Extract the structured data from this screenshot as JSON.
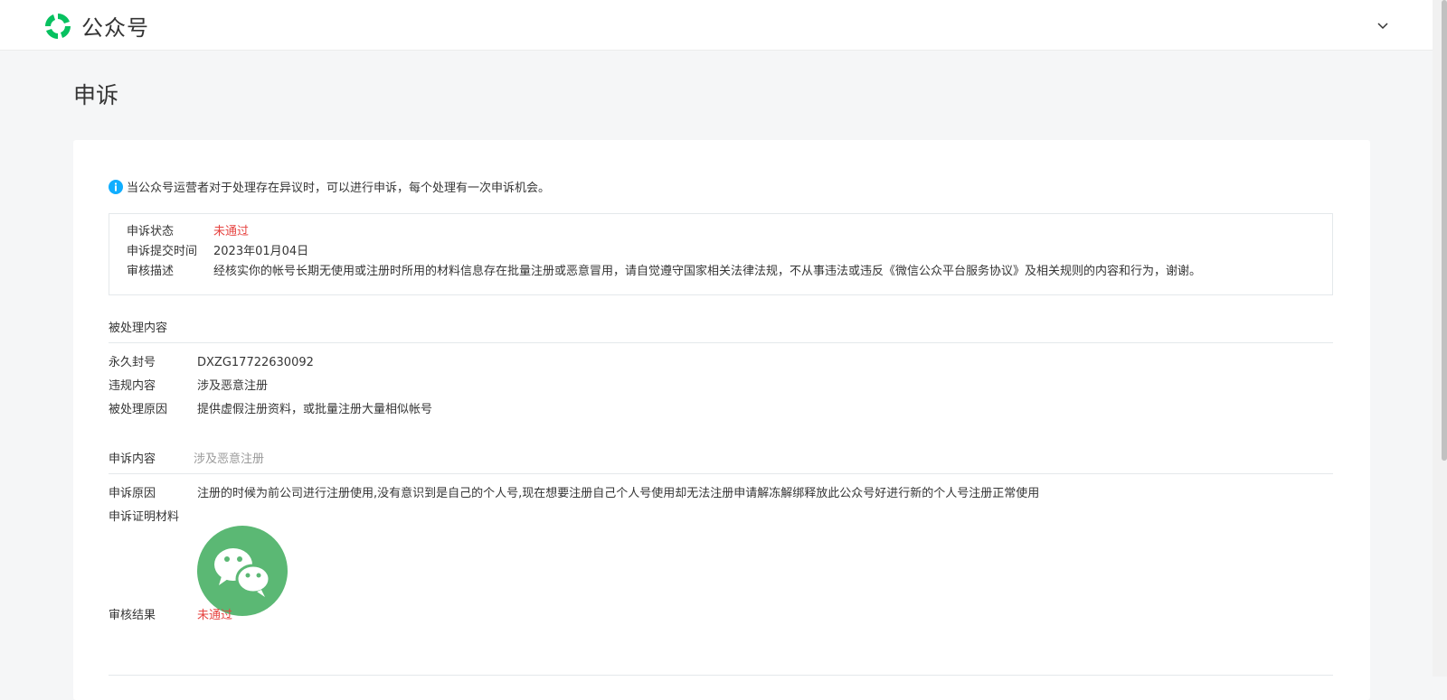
{
  "header": {
    "app_name": "公众号",
    "logo_icon": "wechat-official-account-logo",
    "logo_color": "#07c160"
  },
  "page": {
    "title": "申诉"
  },
  "notice": {
    "icon": "info-icon",
    "text": "当公众号运营者对于处理存在异议时，可以进行申诉，每个处理有一次申诉机会。"
  },
  "status": {
    "rows": [
      {
        "label": "申诉状态",
        "value": "未通过"
      },
      {
        "label": "申诉提交时间",
        "value": "2023年01月04日"
      },
      {
        "label": "审核描述",
        "value": "经核实你的帐号长期无使用或注册时所用的材料信息存在批量注册或恶意冒用，请自觉遵守国家相关法律法规，不从事违法或违反《微信公众平台服务协议》及相关规则的内容和行为，谢谢。"
      }
    ]
  },
  "handled": {
    "title": "被处理内容",
    "rows": [
      {
        "label": "永久封号",
        "value": "DXZG17722630092"
      },
      {
        "label": "违规内容",
        "value": "涉及恶意注册"
      },
      {
        "label": "被处理原因",
        "value": "提供虚假注册资料，或批量注册大量相似帐号"
      }
    ]
  },
  "appeal": {
    "title": "申诉内容",
    "subtitle": "涉及恶意注册",
    "reason_label": "申诉原因",
    "reason_value": "注册的时候为前公司进行注册使用,没有意识到是自己的个人号,现在想要注册自己个人号使用却无法注册申请解冻解绑释放此公众号好进行新的个人号注册正常使用",
    "proof_label": "申诉证明材料",
    "proof_icon": "wechat-icon",
    "result_label": "审核结果",
    "result_value": "未通过"
  },
  "colors": {
    "accent_green": "#07c160",
    "proof_green": "#5bb874",
    "error_red": "#e64340",
    "info_blue": "#10aeff"
  }
}
